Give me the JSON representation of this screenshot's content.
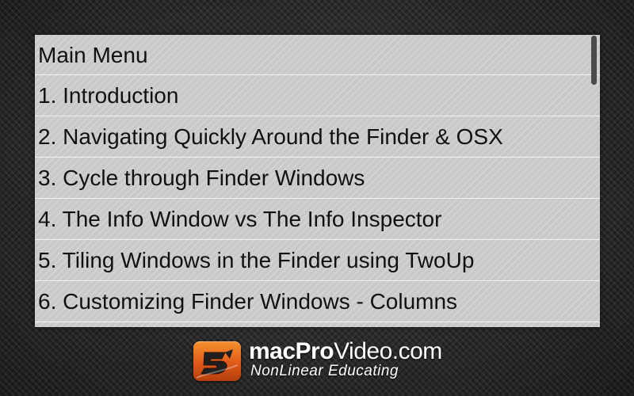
{
  "menu": {
    "title": "Main Menu",
    "items": [
      {
        "label": "1. Introduction"
      },
      {
        "label": "2. Navigating Quickly Around the Finder & OSX"
      },
      {
        "label": "3. Cycle through Finder Windows"
      },
      {
        "label": "4. The Info Window vs The Info Inspector"
      },
      {
        "label": "5. Tiling Windows in the Finder using TwoUp"
      },
      {
        "label": "6. Customizing Finder Windows - Columns"
      }
    ]
  },
  "brand": {
    "name_bold": "macPro",
    "name_rest": "Video.com",
    "tagline": "NonLinear Educating",
    "logo_icon": "macprovideo-logo-icon",
    "accent_color": "#e86a1f"
  }
}
